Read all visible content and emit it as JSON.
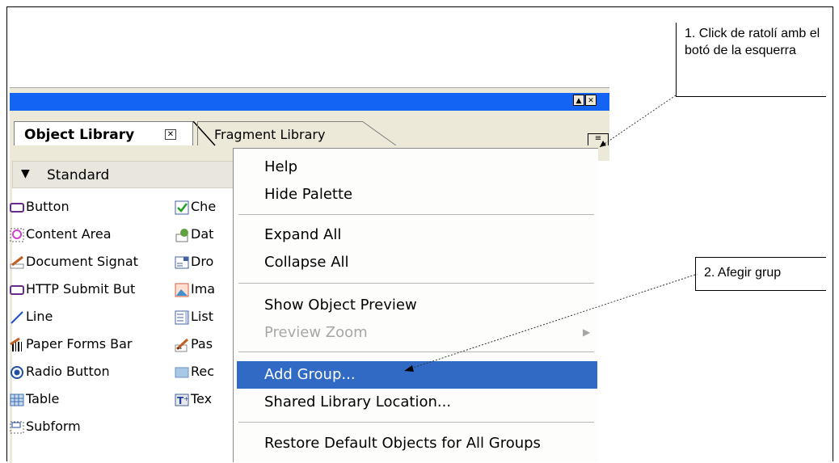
{
  "palette": {
    "tabs": [
      {
        "label": "Object Library"
      },
      {
        "label": "Fragment Library"
      }
    ],
    "group": {
      "label": "Standard"
    },
    "objects_left": [
      {
        "label": "Button",
        "icon": "button-icon"
      },
      {
        "label": "Content Area",
        "icon": "content-area-icon"
      },
      {
        "label": "Document Signat",
        "icon": "signature-icon"
      },
      {
        "label": "HTTP Submit But",
        "icon": "http-submit-icon"
      },
      {
        "label": "Line",
        "icon": "line-icon"
      },
      {
        "label": "Paper Forms Bar",
        "icon": "barcode-icon"
      },
      {
        "label": "Radio Button",
        "icon": "radio-icon"
      },
      {
        "label": "Table",
        "icon": "table-icon"
      },
      {
        "label": "Subform",
        "icon": "subform-icon"
      }
    ],
    "objects_right": [
      {
        "label": "Che",
        "icon": "checkbox-icon"
      },
      {
        "label": "Dat",
        "icon": "date-icon"
      },
      {
        "label": "Dro",
        "icon": "dropdown-icon"
      },
      {
        "label": "Ima",
        "icon": "image-icon"
      },
      {
        "label": "List",
        "icon": "list-icon"
      },
      {
        "label": "Pas",
        "icon": "password-icon"
      },
      {
        "label": "Rec",
        "icon": "rectangle-icon"
      },
      {
        "label": "Tex",
        "icon": "text-icon"
      }
    ]
  },
  "menu": {
    "items": [
      {
        "label": "Help"
      },
      {
        "label": "Hide Palette"
      },
      {
        "label": "Expand All"
      },
      {
        "label": "Collapse All"
      },
      {
        "label": "Show Object Preview"
      },
      {
        "label": "Preview Zoom",
        "disabled": true
      },
      {
        "label": "Add Group...",
        "highlighted": true
      },
      {
        "label": "Shared Library Location..."
      },
      {
        "label": "Restore Default Objects for All Groups"
      }
    ]
  },
  "callouts": [
    {
      "text": "1. Click de ratolí amb el botó de la esquerra"
    },
    {
      "text": "2. Afegir grup"
    }
  ],
  "colors": {
    "titlebar": "#1464f4",
    "highlight": "#316ac5"
  }
}
